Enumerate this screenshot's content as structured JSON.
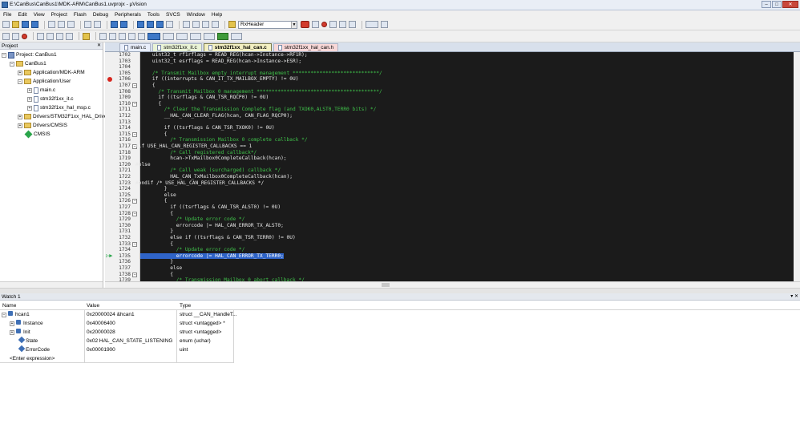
{
  "window": {
    "title": "E:\\CanBus\\CanBus1\\MDK-ARM\\CanBus1.uvprojx - µVision"
  },
  "menu": [
    "File",
    "Edit",
    "View",
    "Project",
    "Flash",
    "Debug",
    "Peripherals",
    "Tools",
    "SVCS",
    "Window",
    "Help"
  ],
  "toolbar": {
    "target_combo": "RxHeader"
  },
  "project_panel": {
    "title": "Project",
    "items": [
      {
        "label": "Project: CanBus1"
      },
      {
        "label": "CanBus1"
      },
      {
        "label": "Application/MDK-ARM"
      },
      {
        "label": "Application/User"
      },
      {
        "label": "main.c"
      },
      {
        "label": "stm32f1xx_it.c"
      },
      {
        "label": "stm32f1xx_hal_msp.c"
      },
      {
        "label": "Drivers/STM32F1xx_HAL_Drive"
      },
      {
        "label": "Drivers/CMSIS"
      },
      {
        "label": "CMSIS"
      }
    ]
  },
  "tabs": [
    {
      "label": "main.c"
    },
    {
      "label": "stm32f1xx_it.c"
    },
    {
      "label": "stm32f1xx_hal_can.c"
    },
    {
      "label": "stm32f1xx_hal_can.h"
    }
  ],
  "code": [
    {
      "n": "1702",
      "t": "    uint32_t rf1rflags = READ_REG(hcan->Instance->RF1R);"
    },
    {
      "n": "1703",
      "t": "    uint32_t esrflags = READ_REG(hcan->Instance->ESR);"
    },
    {
      "n": "1704",
      "t": ""
    },
    {
      "n": "1705",
      "t": "    /* Transmit Mailbox empty interrupt management *****************************/"
    },
    {
      "n": "1706",
      "t": "    if ((interrupts & CAN_IT_TX_MAILBOX_EMPTY) != 0U)"
    },
    {
      "n": "1707",
      "t": "    {"
    },
    {
      "n": "1708",
      "t": "      /* Transmit Mailbox 0 management *****************************************/"
    },
    {
      "n": "1709",
      "t": "      if ((tsrflags & CAN_TSR_RQCP0) != 0U)"
    },
    {
      "n": "1710",
      "t": "      {"
    },
    {
      "n": "1711",
      "t": "        /* Clear the Transmission Complete flag (and TXOK0,ALST0,TERR0 bits) */"
    },
    {
      "n": "1712",
      "t": "        __HAL_CAN_CLEAR_FLAG(hcan, CAN_FLAG_RQCP0);"
    },
    {
      "n": "1713",
      "t": ""
    },
    {
      "n": "1714",
      "t": "        if ((tsrflags & CAN_TSR_TXOK0) != 0U)"
    },
    {
      "n": "1715",
      "t": "        {"
    },
    {
      "n": "1716",
      "t": "          /* Transmission Mailbox 0 complete callback */"
    },
    {
      "n": "1717",
      "t": "#if USE_HAL_CAN_REGISTER_CALLBACKS == 1"
    },
    {
      "n": "1718",
      "t": "          /* Call registered callback*/"
    },
    {
      "n": "1719",
      "t": "          hcan->TxMailbox0CompleteCallback(hcan);"
    },
    {
      "n": "1720",
      "t": "#else"
    },
    {
      "n": "1721",
      "t": "          /* Call weak (surcharged) callback */"
    },
    {
      "n": "1722",
      "t": "          HAL_CAN_TxMailbox0CompleteCallback(hcan);"
    },
    {
      "n": "1723",
      "t": "#endif /* USE_HAL_CAN_REGISTER_CALLBACKS */"
    },
    {
      "n": "1724",
      "t": "        }"
    },
    {
      "n": "1725",
      "t": "        else"
    },
    {
      "n": "1726",
      "t": "        {"
    },
    {
      "n": "1727",
      "t": "          if ((tsrflags & CAN_TSR_ALST0) != 0U)"
    },
    {
      "n": "1728",
      "t": "          {"
    },
    {
      "n": "1729",
      "t": "            /* Update error code */"
    },
    {
      "n": "1730",
      "t": "            errorcode |= HAL_CAN_ERROR_TX_ALST0;"
    },
    {
      "n": "1731",
      "t": "          }"
    },
    {
      "n": "1732",
      "t": "          else if ((tsrflags & CAN_TSR_TERR0) != 0U)"
    },
    {
      "n": "1733",
      "t": "          {"
    },
    {
      "n": "1734",
      "t": "            /* Update error code */"
    },
    {
      "n": "1735",
      "t": "            errorcode |= HAL_CAN_ERROR_TX_TERR0;"
    },
    {
      "n": "1736",
      "t": "          }"
    },
    {
      "n": "1737",
      "t": "          else"
    },
    {
      "n": "1738",
      "t": "          {"
    },
    {
      "n": "1739",
      "t": "            /* Transmission Mailbox 0 abort callback */"
    }
  ],
  "watch": {
    "title": "Watch 1",
    "columns": [
      "Name",
      "Value",
      "Type"
    ],
    "rows": [
      {
        "name": "hcan1",
        "value": "0x20000024 &hcan1",
        "type": "struct __CAN_HandleT..."
      },
      {
        "name": "Instance",
        "value": "0x40006400",
        "type": "struct <untagged> *"
      },
      {
        "name": "Init",
        "value": "0x20000028",
        "type": "struct <untagged>"
      },
      {
        "name": "State",
        "value": "0x02 HAL_CAN_STATE_LISTENING",
        "type": "enum (uchar)"
      },
      {
        "name": "ErrorCode",
        "value": "0x00001900",
        "type": "uint"
      },
      {
        "name": "<Enter expression>",
        "value": "",
        "type": ""
      }
    ]
  }
}
